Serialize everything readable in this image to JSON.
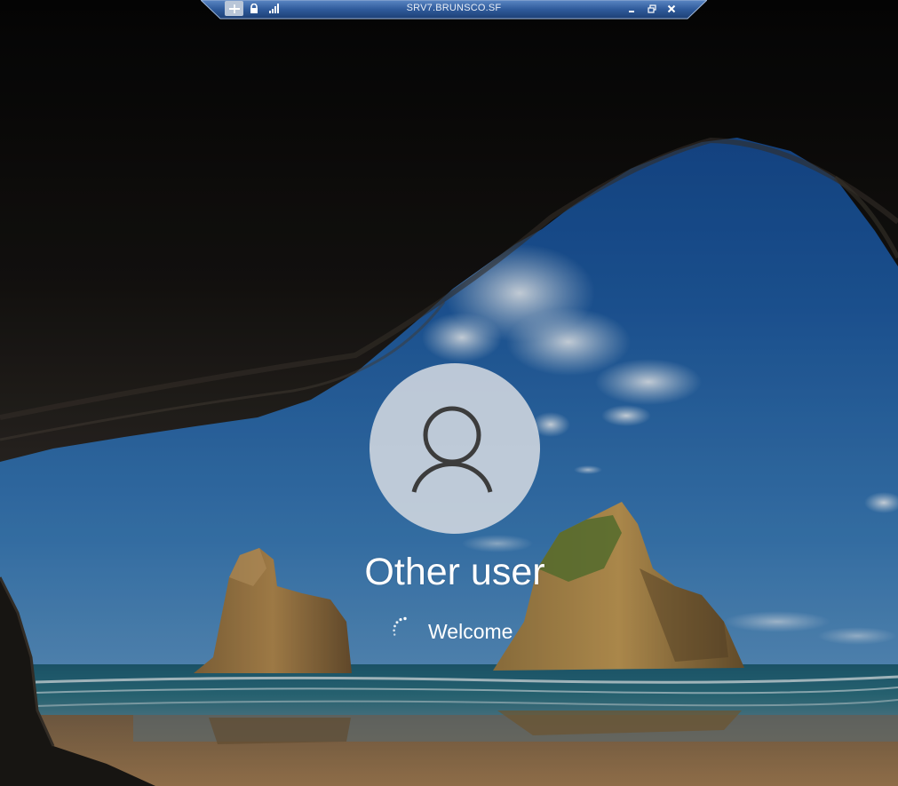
{
  "connection_bar": {
    "title": "SRV7.BRUNSCO.SF",
    "icons": [
      "pin-icon",
      "lock-icon",
      "signal-icon",
      "minimize-icon",
      "restore-icon",
      "close-icon"
    ]
  },
  "login": {
    "user_name": "Other user",
    "status": "Welcome",
    "avatar_icon": "user-silhouette-icon",
    "spinner_icon": "loading-spinner-icon"
  },
  "colors": {
    "bar_blue": "#2f5b9b",
    "avatar_bg": "#d6dbe2",
    "text": "#ffffff"
  }
}
